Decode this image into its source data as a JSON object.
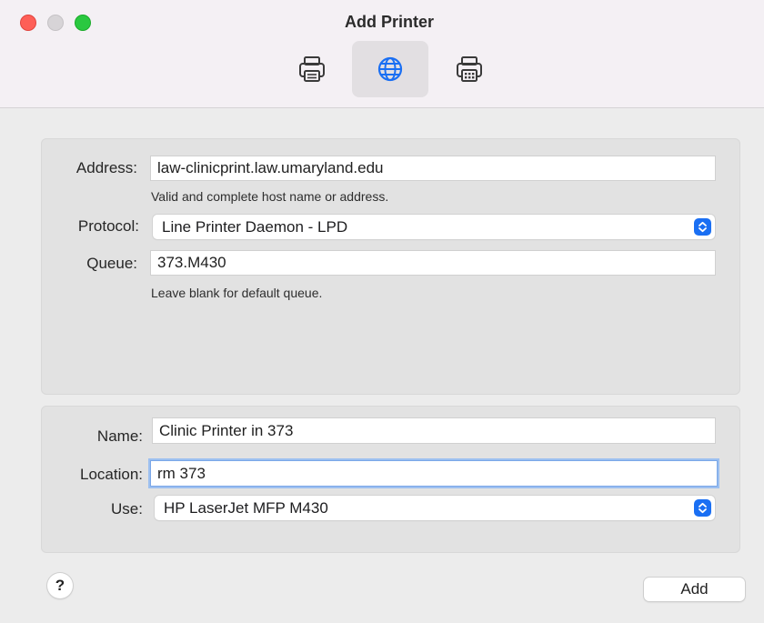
{
  "window": {
    "title": "Add Printer"
  },
  "toolbar": {
    "items": [
      {
        "icon": "printer-icon",
        "selected": false
      },
      {
        "icon": "globe-icon",
        "selected": true
      },
      {
        "icon": "fax-printer-icon",
        "selected": false
      }
    ]
  },
  "connection": {
    "address_label": "Address:",
    "address_value": "law-clinicprint.law.umaryland.edu",
    "address_hint": "Valid and complete host name or address.",
    "protocol_label": "Protocol:",
    "protocol_value": "Line Printer Daemon - LPD",
    "queue_label": "Queue:",
    "queue_value": "373.M430",
    "queue_hint": "Leave blank for default queue."
  },
  "details": {
    "name_label": "Name:",
    "name_value": "Clinic Printer in 373",
    "location_label": "Location:",
    "location_value": "rm 373",
    "use_label": "Use:",
    "use_value": "HP LaserJet MFP M430"
  },
  "footer": {
    "help_label": "?",
    "add_label": "Add"
  },
  "colors": {
    "accent": "#1a6ff3",
    "close": "#fe5f57",
    "maximize": "#2ac840"
  }
}
